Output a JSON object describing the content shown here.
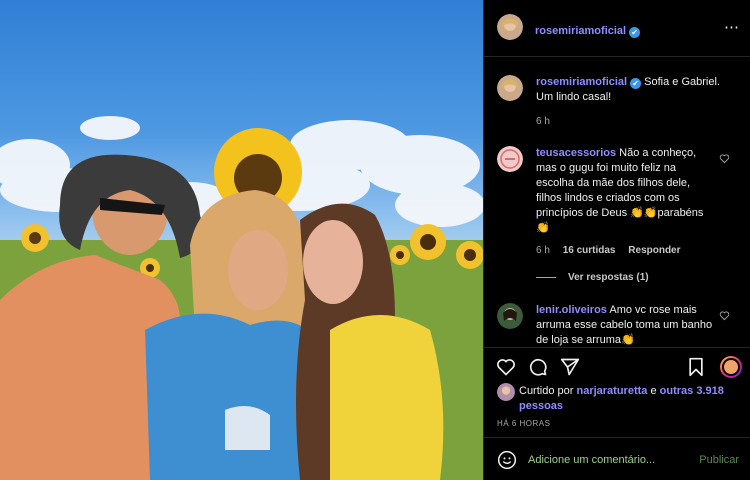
{
  "post": {
    "author": "rosemiriamoficial",
    "verified": "✔",
    "more_icon": "⋯"
  },
  "caption": {
    "author": "rosemiriamoficial",
    "verified": "✔",
    "text": "Sofia e Gabriel. Um lindo casal!",
    "time": "6 h"
  },
  "comments": [
    {
      "author": "teusacessorios",
      "text": "Não a conheço, mas o gugu foi muito feliz na escolha da mãe dos filhos dele, filhos lindos e criados com os princípios de Deus 👏👏parabéns 👏",
      "time": "6 h",
      "likes": "16 curtidas",
      "reply": "Responder",
      "view_replies": "Ver respostas (1)"
    },
    {
      "author": "lenir.oliveiros",
      "text": "Amo vc rose mais arruma esse cabelo toma um banho de loja se arruma👏"
    }
  ],
  "actions": {
    "like_icon": "heart-icon",
    "comment_icon": "comment-icon",
    "share_icon": "share-icon",
    "save_icon": "bookmark-icon"
  },
  "likes": {
    "prefix": "Curtido por",
    "user": "narjaraturetta",
    "connector": "e",
    "others": "outras 3.918 pessoas"
  },
  "timestamp": "HÁ 6 HORAS",
  "comment_input": {
    "emoji_icon": "emoji-icon",
    "placeholder": "Adicione um comentário...",
    "post_label": "Publicar"
  },
  "colors": {
    "username": "#8f8dff",
    "background": "#000000",
    "accent": "#3897f0",
    "input_text": "#9bd18a"
  }
}
